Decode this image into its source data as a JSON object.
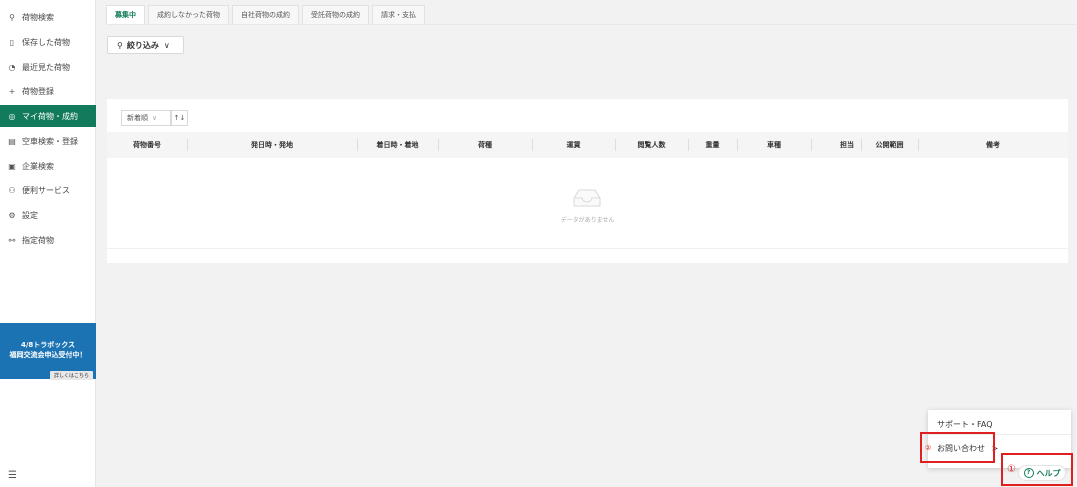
{
  "sidebar": {
    "items": [
      {
        "icon": "search-icon",
        "glyph": "⚲",
        "label": "荷物検索"
      },
      {
        "icon": "bookmark-icon",
        "glyph": "▯",
        "label": "保存した荷物"
      },
      {
        "icon": "history-icon",
        "glyph": "◔",
        "label": "最近見た荷物"
      },
      {
        "icon": "plus-icon",
        "glyph": "+",
        "label": "荷物登録"
      },
      {
        "icon": "package-icon",
        "glyph": "◎",
        "label": "マイ荷物・成約"
      },
      {
        "icon": "truck-icon",
        "glyph": "▤",
        "label": "空車検索・登録"
      },
      {
        "icon": "building-icon",
        "glyph": "▣",
        "label": "企業検索"
      },
      {
        "icon": "service-icon",
        "glyph": "⚇",
        "label": "便利サービス"
      },
      {
        "icon": "gear-icon",
        "glyph": "⚙",
        "label": "設定"
      },
      {
        "icon": "users-icon",
        "glyph": "⚯",
        "label": "指定荷物"
      }
    ],
    "active_index": 4,
    "banner": {
      "line1": "4/8トラボックス",
      "line2": "福岡交流会申込受付中！",
      "more": "詳しくはこちら"
    },
    "collapse_glyph": "☰"
  },
  "tabs": [
    "募集中",
    "成約しなかった荷物",
    "自社荷物の成約",
    "受託荷物の成約",
    "請求・支払"
  ],
  "filter": {
    "label": "絞り込み",
    "icon_glyph": "⚲",
    "chevron": "∨"
  },
  "table": {
    "sort_label": "新着順",
    "sort_chevron": "∨",
    "sort_toggle": "↑↓",
    "columns": [
      "荷物番号",
      "発日時・発地",
      "着日時・着地",
      "荷種",
      "運賃",
      "閲覧人数",
      "重量",
      "車種",
      "担当",
      "公開範囲",
      "備考"
    ],
    "empty_text": "データがありません"
  },
  "help": {
    "support_label": "サポート・FAQ",
    "contact_label": "お問い合わせ",
    "contact_chevron": ">",
    "help_label": "ヘルプ",
    "help_icon_glyph": "?",
    "marker1": "①",
    "marker2": "②"
  },
  "colors": {
    "accent": "#127b5b",
    "banner": "#1c73b4",
    "highlight": "#e02020"
  }
}
